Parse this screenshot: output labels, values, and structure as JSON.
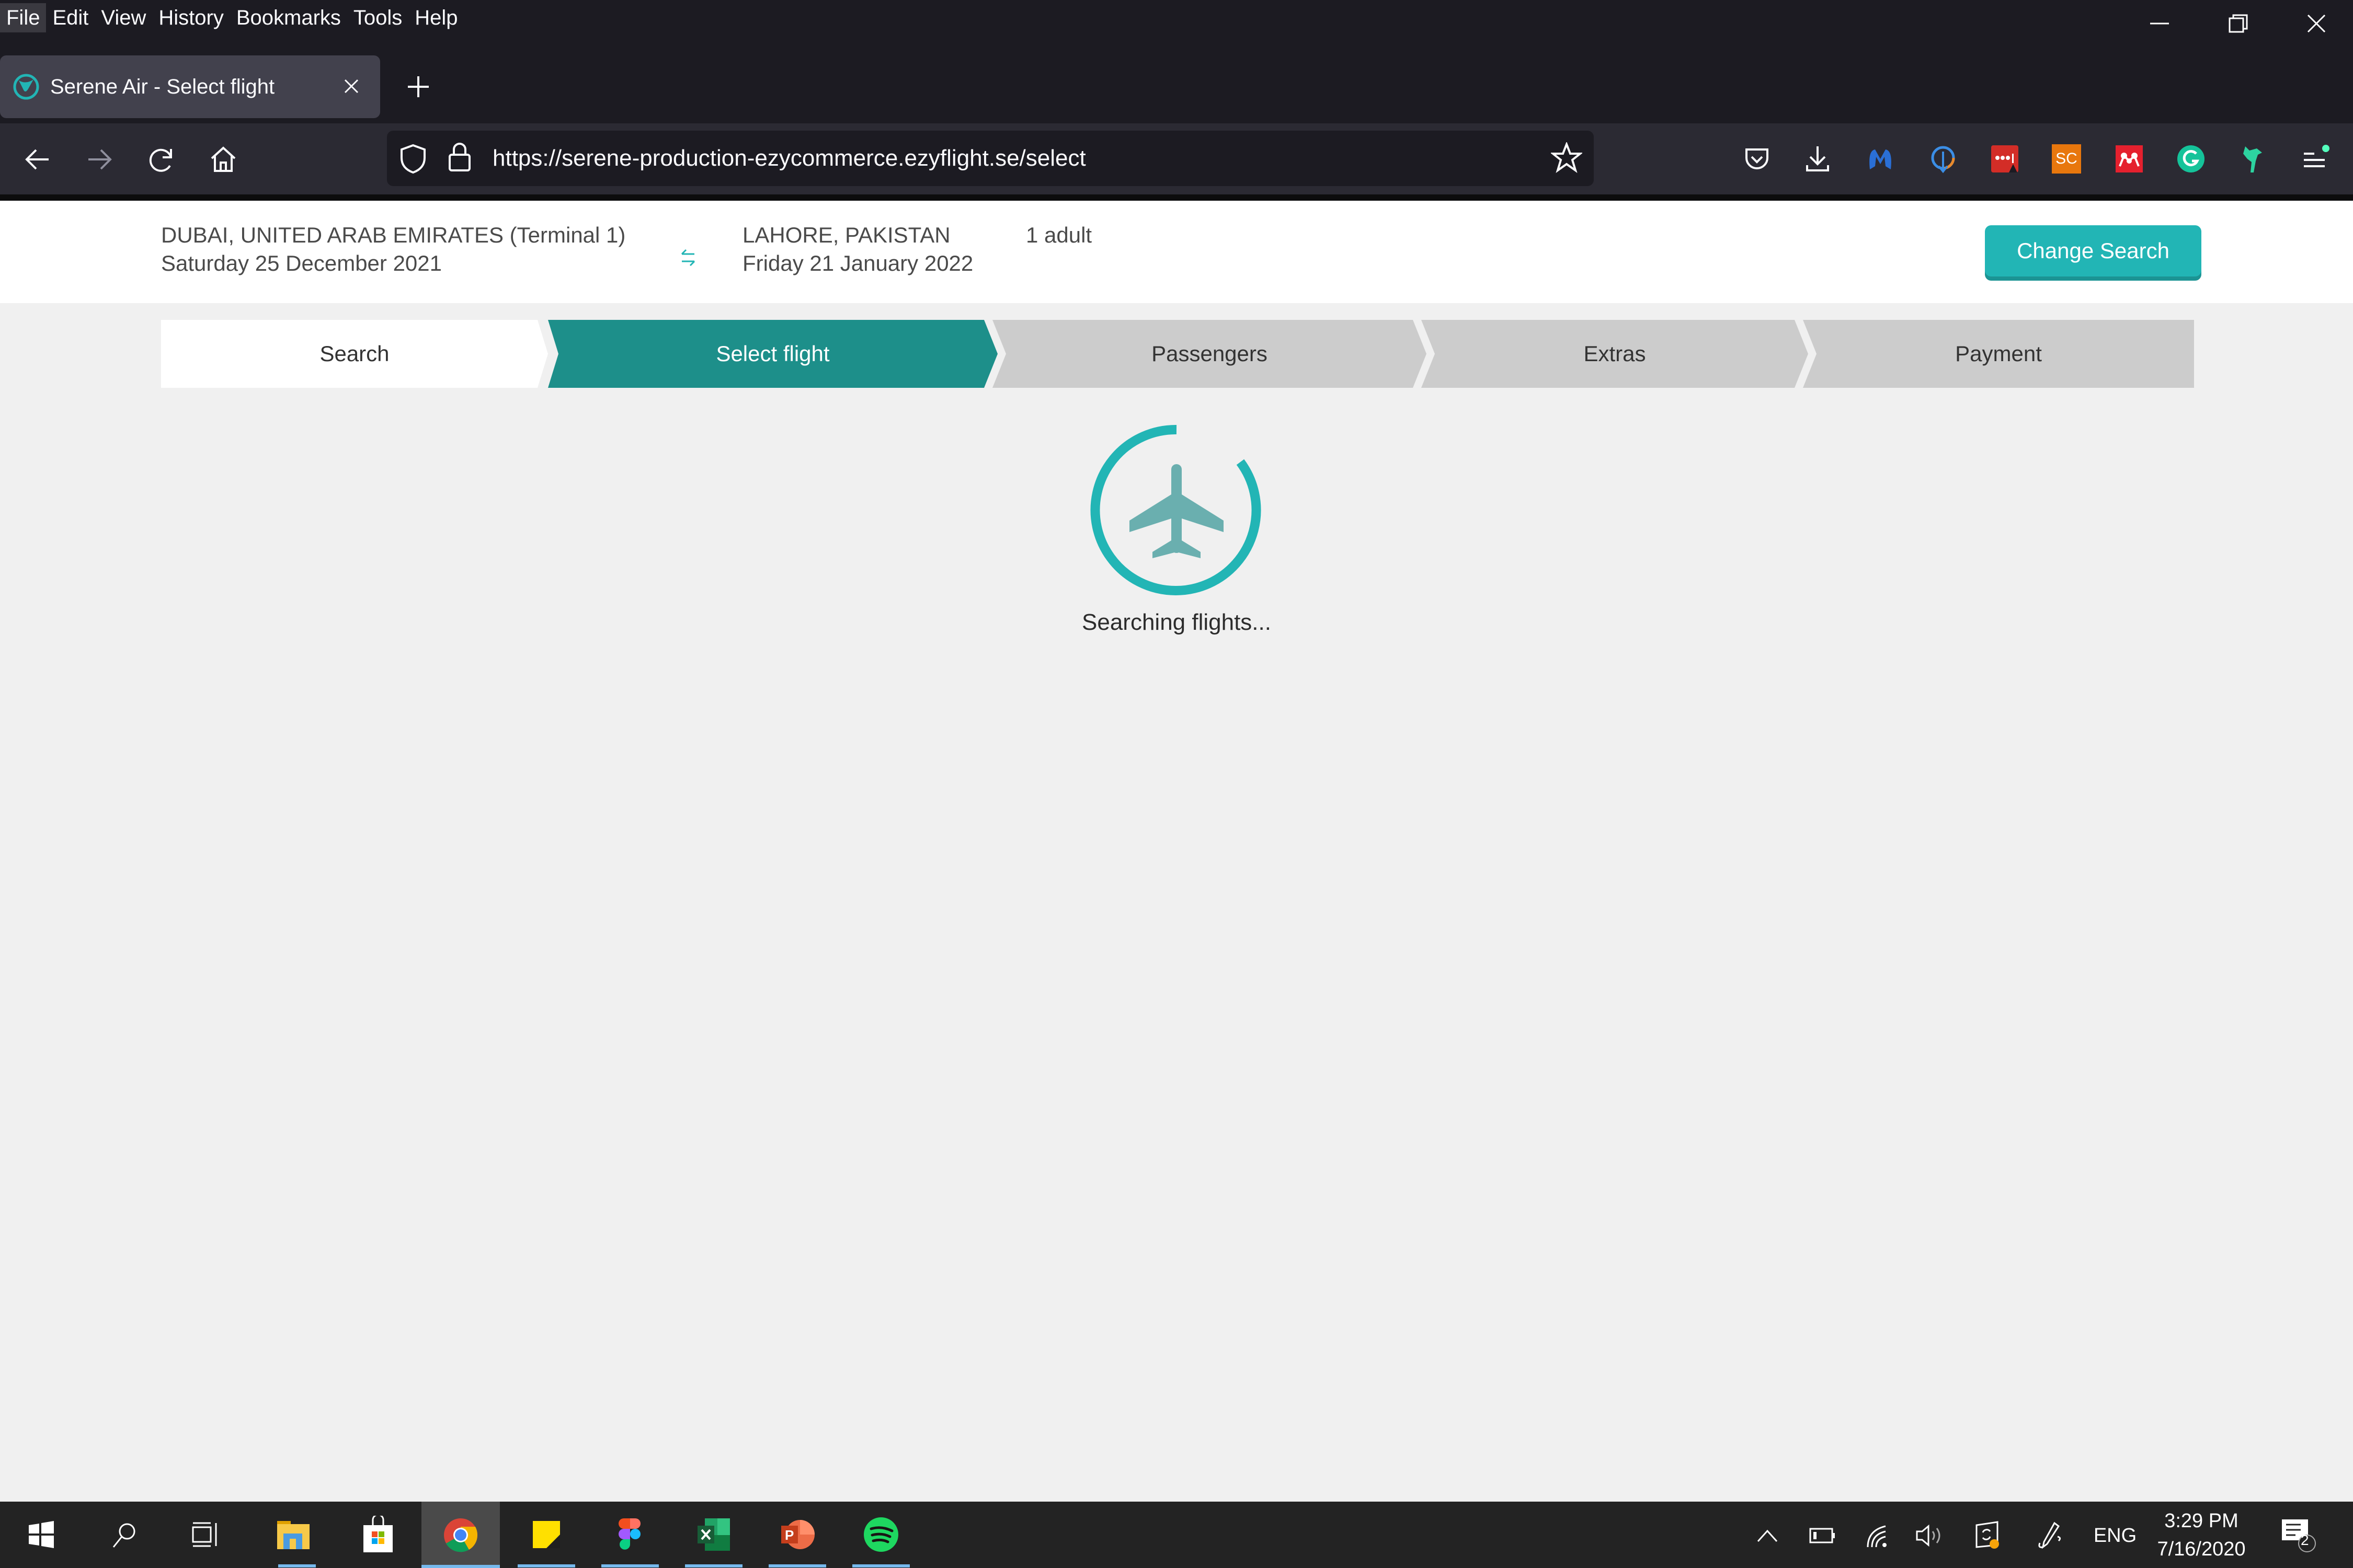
{
  "browser": {
    "menu": [
      "File",
      "Edit",
      "View",
      "History",
      "Bookmarks",
      "Tools",
      "Help"
    ],
    "tab": {
      "title": "Serene Air - Select flight",
      "favicon": "serene-air-logo-icon"
    },
    "url": "https://serene-production-ezycommerce.ezyflight.se/select",
    "extensions": [
      "pocket-icon",
      "downloads-icon",
      "malwarebytes-icon",
      "extension-blue-icon",
      "lastpass-icon",
      "sc-icon",
      "mendeley-icon",
      "grammarly-icon",
      "extension-green-icon",
      "menu-icon"
    ],
    "extension_labels": {
      "sc": "SC"
    }
  },
  "search_summary": {
    "origin": "DUBAI, UNITED ARAB EMIRATES (Terminal 1)",
    "depart_date": "Saturday 25 December 2021",
    "destination": "LAHORE, PAKISTAN",
    "return_date": "Friday 21 January 2022",
    "passengers": "1 adult",
    "change_search_label": "Change Search"
  },
  "stepper": {
    "steps": [
      {
        "label": "Search",
        "state": "completed"
      },
      {
        "label": "Select flight",
        "state": "active"
      },
      {
        "label": "Passengers",
        "state": "pending"
      },
      {
        "label": "Extras",
        "state": "pending"
      },
      {
        "label": "Payment",
        "state": "pending"
      }
    ]
  },
  "loader": {
    "text": "Searching flights..."
  },
  "colors": {
    "accent": "#22b5b5",
    "active_step": "#1d8f8a",
    "pending_step": "#cccccc",
    "plane": "#6aafaf"
  },
  "taskbar": {
    "apps": [
      "start",
      "search",
      "task-view",
      "file-explorer",
      "microsoft-store",
      "chrome",
      "sticky-notes",
      "figma",
      "excel",
      "powerpoint",
      "spotify"
    ],
    "language": "ENG",
    "time": "3:29 PM",
    "date": "7/16/2020",
    "notifications": "2"
  }
}
